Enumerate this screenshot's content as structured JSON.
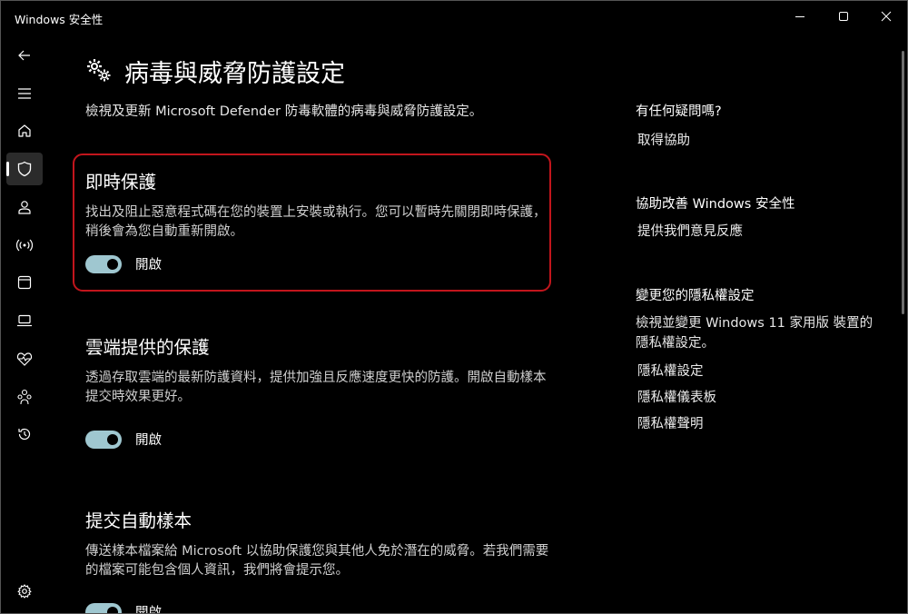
{
  "window": {
    "title": "Windows 安全性"
  },
  "nav": {
    "items": [
      {
        "icon": "back-arrow-icon"
      },
      {
        "icon": "hamburger-menu-icon"
      },
      {
        "icon": "home-icon"
      },
      {
        "icon": "shield-icon",
        "active": true
      },
      {
        "icon": "person-icon"
      },
      {
        "icon": "wireless-signal-icon"
      },
      {
        "icon": "app-browser-icon"
      },
      {
        "icon": "laptop-icon"
      },
      {
        "icon": "heart-pulse-icon"
      },
      {
        "icon": "family-icon"
      },
      {
        "icon": "history-icon"
      },
      {
        "icon": "settings-gear-icon"
      }
    ]
  },
  "page": {
    "title": "病毒與威脅防護設定",
    "description": "檢視及更新 Microsoft Defender 防毒軟體的病毒與威脅防護設定。"
  },
  "sections": [
    {
      "heading": "即時保護",
      "description": "找出及阻止惡意程式碼在您的裝置上安裝或執行。您可以暫時先關閉即時保護，稍後會為您自動重新開啟。",
      "toggle_label": "開啟",
      "toggle_on": true
    },
    {
      "heading": "雲端提供的保護",
      "description": "透過存取雲端的最新防護資料，提供加強且反應速度更快的防護。開啟自動樣本提交時效果更好。",
      "toggle_label": "開啟",
      "toggle_on": true
    },
    {
      "heading": "提交自動樣本",
      "description": "傳送樣本檔案給 Microsoft 以協助保護您與其他人免於潛在的威脅。若我們需要的檔案可能包含個人資訊，我們將會提示您。",
      "toggle_label": "開啟",
      "toggle_on": true
    }
  ],
  "side": {
    "help_heading": "有任何疑問嗎?",
    "help_link": "取得協助",
    "improve_heading": "協助改善 Windows 安全性",
    "improve_link": "提供我們意見反應",
    "privacy_heading": "變更您的隱私權設定",
    "privacy_text": "檢視並變更 Windows 11 家用版 裝置的隱私權設定。",
    "privacy_links": [
      "隱私權設定",
      "隱私權儀表板",
      "隱私權聲明"
    ]
  },
  "colors": {
    "highlight_border": "#c2151c",
    "toggle_on": "#9fc7d0"
  }
}
